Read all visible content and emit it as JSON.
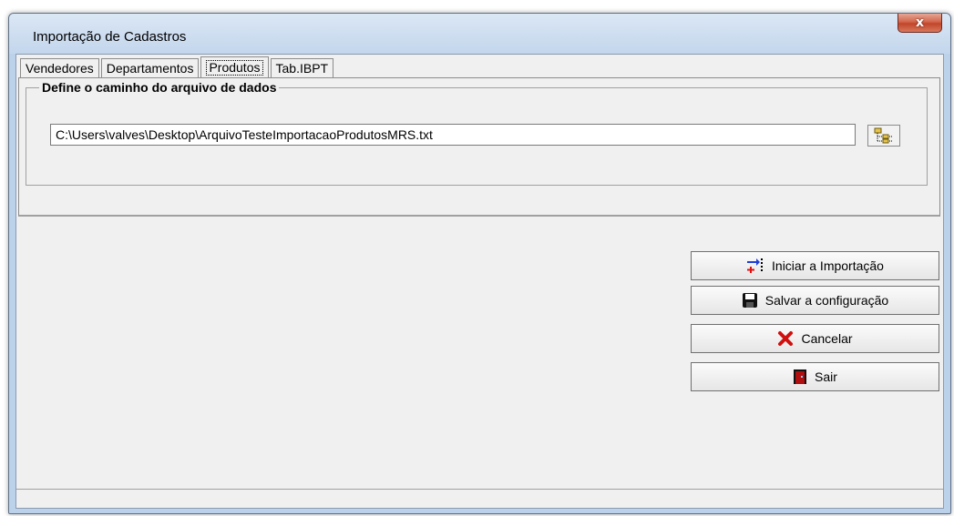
{
  "window": {
    "title": "Importação de Cadastros",
    "close_glyph": "x"
  },
  "tabs": [
    {
      "label": "Vendedores",
      "active": false
    },
    {
      "label": "Departamentos",
      "active": false
    },
    {
      "label": "Produtos",
      "active": true
    },
    {
      "label": "Tab.IBPT",
      "active": false
    }
  ],
  "group": {
    "title": "Define o caminho do arquivo de dados",
    "path_value": "C:\\Users\\valves\\Desktop\\ArquivoTesteImportacaoProdutosMRS.txt",
    "browse_icon": "folder-tree-icon"
  },
  "buttons": {
    "start_import": {
      "label": "Iniciar a Importação",
      "icon": "import-arrows-icon"
    },
    "save_config": {
      "label": "Salvar a configuração",
      "icon": "floppy-disk-icon"
    },
    "cancel": {
      "label": "Cancelar",
      "icon": "red-x-icon"
    },
    "exit": {
      "label": "Sair",
      "icon": "exit-door-icon"
    }
  },
  "colors": {
    "close_button": "#c8452a",
    "window_frame": "#bcd2ea"
  }
}
